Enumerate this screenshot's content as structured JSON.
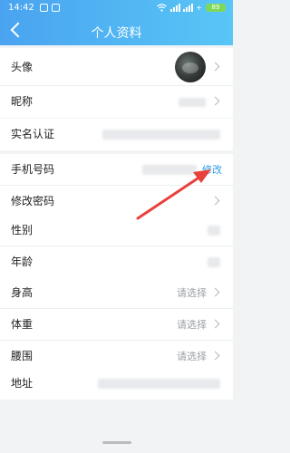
{
  "status": {
    "time": "14:42",
    "battery": "89"
  },
  "header": {
    "title": "个人资料"
  },
  "rows": {
    "avatar_label": "头像",
    "nickname_label": "昵称",
    "realname_label": "实名认证",
    "phone_label": "手机号码",
    "phone_edit": "修改",
    "password_label": "修改密码",
    "gender_label": "性别",
    "age_label": "年龄",
    "height_label": "身高",
    "height_value": "请选择",
    "weight_label": "体重",
    "weight_value": "请选择",
    "waist_label": "腰围",
    "waist_value": "请选择",
    "address_label": "地址"
  },
  "colors": {
    "header_start": "#4aa3f0",
    "header_end": "#58c6f6",
    "accent": "#2d9ee9",
    "arrow": "#e8413b"
  }
}
